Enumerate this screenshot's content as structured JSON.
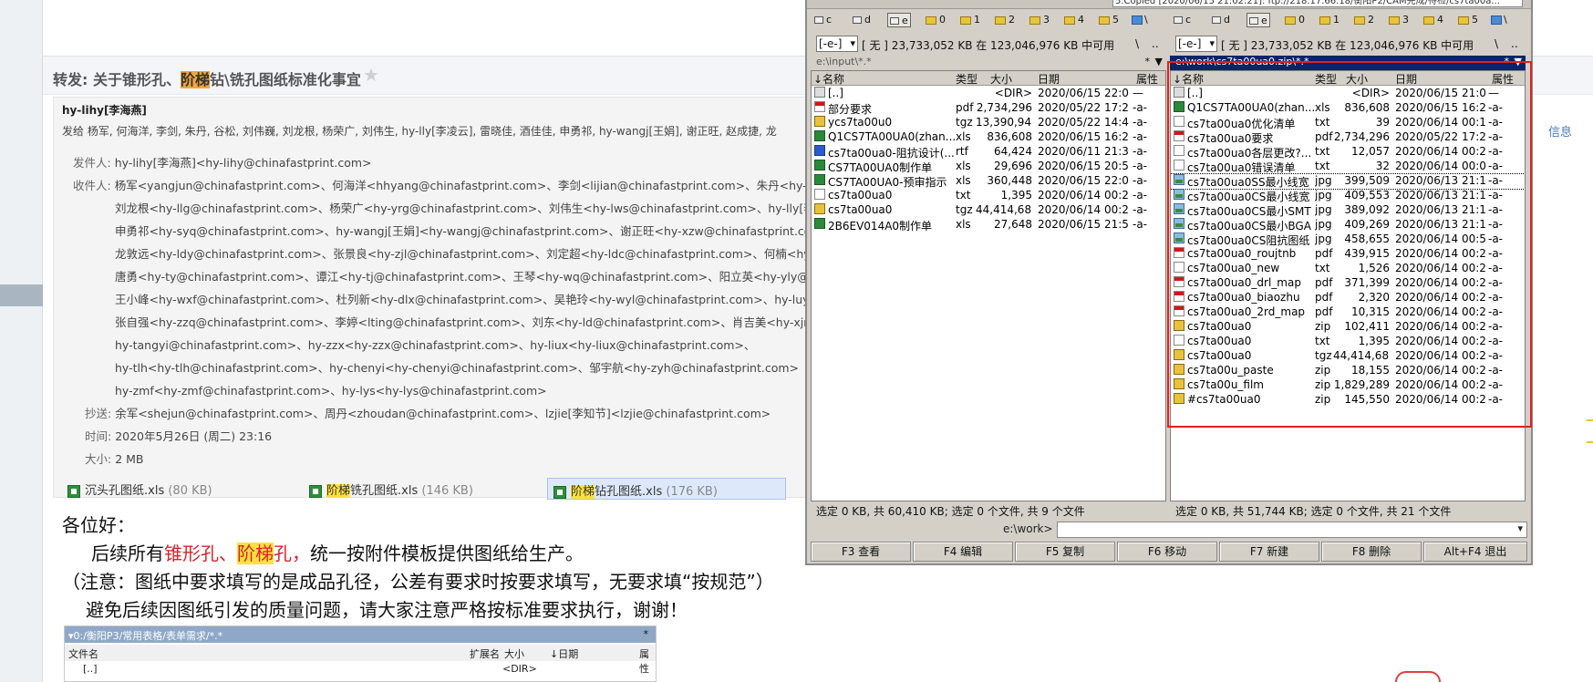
{
  "mail": {
    "subject_prefix": "转发: 关于锥形孔、",
    "subject_highlight": "阶梯",
    "subject_suffix": "钻\\铣孔图纸标准化事宜",
    "sender_name": "hy-lihy[李海燕]",
    "send_to_list": "发给 杨军, 何海洋, 李剑, 朱丹, 谷松, 刘伟巍, 刘龙根, 杨荣广, 刘伟生, hy-lly[李凌云], 雷晓佳, 酒佳佳, 申勇祁, hy-wangj[王娟], 谢正旺, 赵成捷, 龙",
    "right_info": "信息",
    "from_label": "发件人:",
    "from_value": "hy-lihy[李海燕]<hy-lihy@chinafastprint.com>",
    "to_label": "收件人:",
    "to_lines": [
      "杨军<yangjun@chinafastprint.com>、何海洋<hhyang@chinafastprint.com>、李剑<lijian@chinafastprint.com>、朱丹<hy-zd",
      "刘龙根<hy-llg@chinafastprint.com>、杨荣广<hy-yrg@chinafastprint.com>、刘伟生<hy-lws@chinafastprint.com>、hy-lly[李",
      "申勇祁<hy-syq@chinafastprint.com>、hy-wangj[王娟]<hy-wangj@chinafastprint.com>、谢正旺<hy-xzw@chinafastprint.com",
      "龙敦远<hy-ldy@chinafastprint.com>、张景良<hy-zjl@chinafastprint.com>、刘定超<hy-ldc@chinafastprint.com>、何楠<hy",
      "唐勇<hy-ty@chinafastprint.com>、谭江<hy-tj@chinafastprint.com>、王琴<hy-wq@chinafastprint.com>、阳立英<hy-yly@",
      "王小峰<hy-wxf@chinafastprint.com>、杜列新<hy-dlx@chinafastprint.com>、吴艳玲<hy-wyl@chinafastprint.com>、hy-luy",
      "张自强<hy-zzq@chinafastprint.com>、李婷<lting@chinafastprint.com>、刘东<hy-ld@chinafastprint.com>、肖吉美<hy-xjm",
      "hy-tangyi@chinafastprint.com>、hy-zzx<hy-zzx@chinafastprint.com>、hy-liux<hy-liux@chinafastprint.com>、",
      "hy-tlh<hy-tlh@chinafastprint.com>、hy-chenyi<hy-chenyi@chinafastprint.com>、邹宇航<hy-zyh@chinafastprint.com>",
      "hy-zmf<hy-zmf@chinafastprint.com>、hy-lys<hy-lys@chinafastprint.com>"
    ],
    "cc_label": "抄送:",
    "cc_value": "余军<shejun@chinafastprint.com>、周丹<zhoudan@chinafastprint.com>、lzjie[李知节]<lzjie@chinafastprint.com>",
    "time_label": "时间:",
    "time_value": "2020年5月26日 (周二) 23:16",
    "size_label": "大小:",
    "size_value": "2 MB",
    "attachments": [
      {
        "pre": "",
        "hl": "",
        "post": "沉头孔图纸.xls",
        "size": "(80 KB)"
      },
      {
        "pre": "",
        "hl": "阶梯",
        "post": "铣孔图纸.xls",
        "size": "(146 KB)"
      },
      {
        "pre": "",
        "hl": "阶梯",
        "post": "钻孔图纸.xls",
        "size": "(176 KB)"
      }
    ],
    "body": {
      "greeting": "各位好：",
      "line1_pre": "后续所有",
      "line1_red1": "锥形孔、",
      "line1_hl": "阶梯",
      "line1_red2": "孔，",
      "line1_post": "统一按附件模板提供图纸给生产。",
      "line2": "（注意：图纸中要求填写的是成品孔径，公差有要求时按要求填写，无要求填“按规范”）",
      "line3": "避免后续因图纸引发的质量问题，请大家注意严格按标准要求执行，谢谢！"
    },
    "embed": {
      "path": "▾0:/衡阳P3/常用表格/表单需求/*.*",
      "star": "*",
      "cols": {
        "name": "文件名",
        "ext": "扩展名",
        "size": "大小",
        "date": "↓日期",
        "attr": "属性"
      },
      "row1_name": "[..]",
      "row1_size": "<DIR>"
    }
  },
  "tc": {
    "top_message": "5.Copied [2020/06/15 21:02:21]: ftp://218.17.66.18/衡阳P2/CAM完成/待检/cs7ta00a...",
    "drives": [
      "c",
      "d",
      "e",
      "0",
      "1",
      "2",
      "3",
      "4",
      "5",
      "\\"
    ],
    "active_drive": "e",
    "left": {
      "drive_sel": "[-e-]",
      "space": "[ 无 ]  23,733,052 KB 在 123,046,976 KB 中可用",
      "back": "\\",
      "up": "..",
      "path": "e:\\input\\*.*",
      "star": "*",
      "arrow": "▼",
      "cols": {
        "name": "↓名称",
        "ext": "类型",
        "size": "大小",
        "date": "日期",
        "attr": "属性"
      },
      "files": [
        {
          "icon": "up",
          "name": "[..]",
          "ext": "",
          "size": "<DIR>",
          "date": "2020/06/15 22:09",
          "attr": "—"
        },
        {
          "icon": "pdf",
          "name": "部分要求",
          "ext": "pdf",
          "size": "2,734,296",
          "date": "2020/05/22 17:29",
          "attr": "-a-"
        },
        {
          "icon": "tgz",
          "name": "ycs7ta00u0",
          "ext": "tgz",
          "size": "13,390,947",
          "date": "2020/05/22 14:48",
          "attr": "-a-"
        },
        {
          "icon": "xls",
          "name": "Q1CS7TA00UA0(zhan...",
          "ext": "xls",
          "size": "836,608",
          "date": "2020/06/15 16:27",
          "attr": "-a-"
        },
        {
          "icon": "rtf",
          "name": "cs7ta00ua0-阻抗设计(...",
          "ext": "rtf",
          "size": "64,424",
          "date": "2020/06/11 21:39",
          "attr": "-a-"
        },
        {
          "icon": "xls",
          "name": "CS7TA00UA0制作单",
          "ext": "xls",
          "size": "29,696",
          "date": "2020/06/15 20:59",
          "attr": "-a-"
        },
        {
          "icon": "xls",
          "name": "CS7TA00UA0-预审指示",
          "ext": "xls",
          "size": "360,448",
          "date": "2020/06/15 22:09",
          "attr": "-a-"
        },
        {
          "icon": "txt",
          "name": "cs7ta00ua0",
          "ext": "txt",
          "size": "1,395",
          "date": "2020/06/14 00:20",
          "attr": "-a-"
        },
        {
          "icon": "tgz",
          "name": "cs7ta00ua0",
          "ext": "tgz",
          "size": "44,414,689",
          "date": "2020/06/14 00:24",
          "attr": "-a-"
        },
        {
          "icon": "xls",
          "name": "2B6EV014A0制作单",
          "ext": "xls",
          "size": "27,648",
          "date": "2020/06/15 21:59",
          "attr": "-a-"
        }
      ],
      "status": "选定 0 KB, 共 60,410 KB; 选定 0 个文件, 共 9 个文件"
    },
    "right": {
      "drive_sel": "[-e-]",
      "space": "[ 无 ]  23,733,052 KB 在 123,046,976 KB 中可用",
      "back": "\\",
      "up": "..",
      "path": "e:\\work\\cs7ta00ua0.zip\\*.*",
      "star": "*",
      "arrow": "▼",
      "cols": {
        "name": "↓名称",
        "ext": "类型",
        "size": "大小",
        "date": "日期",
        "attr": "属性"
      },
      "files": [
        {
          "icon": "up",
          "name": "[..]",
          "ext": "",
          "size": "<DIR>",
          "date": "2020/06/15 21:02",
          "attr": "—"
        },
        {
          "icon": "xls",
          "name": "Q1CS7TA00UA0(zhan...",
          "ext": "xls",
          "size": "836,608",
          "date": "2020/06/15 16:27",
          "attr": "-a-"
        },
        {
          "icon": "txt",
          "name": "cs7ta00ua0优化清单",
          "ext": "txt",
          "size": "39",
          "date": "2020/06/14 00:19",
          "attr": "-a-"
        },
        {
          "icon": "pdf",
          "name": "cs7ta00ua0要求",
          "ext": "pdf",
          "size": "2,734,296",
          "date": "2020/05/22 17:29",
          "attr": "-a-"
        },
        {
          "icon": "txt",
          "name": "cs7ta00ua0各层更改?...",
          "ext": "txt",
          "size": "12,057",
          "date": "2020/06/14 00:20",
          "attr": "-a-"
        },
        {
          "icon": "txt",
          "name": "cs7ta00ua0错误清单",
          "ext": "txt",
          "size": "32",
          "date": "2020/06/14 00:09",
          "attr": "-a-"
        },
        {
          "icon": "jpg",
          "name": "cs7ta00ua0SS最小线宽",
          "ext": "jpg",
          "size": "399,509",
          "date": "2020/06/13 21:13",
          "attr": "-a-"
        },
        {
          "icon": "jpg",
          "name": "cs7ta00ua0CS最小线宽",
          "ext": "jpg",
          "size": "409,553",
          "date": "2020/06/13 21:13",
          "attr": "-a-"
        },
        {
          "icon": "jpg",
          "name": "cs7ta00ua0CS最小SMT",
          "ext": "jpg",
          "size": "389,092",
          "date": "2020/06/13 21:13",
          "attr": "-a-"
        },
        {
          "icon": "jpg",
          "name": "cs7ta00ua0CS最小BGA",
          "ext": "jpg",
          "size": "409,269",
          "date": "2020/06/13 21:13",
          "attr": "-a-"
        },
        {
          "icon": "jpg",
          "name": "cs7ta00ua0CS阻抗图纸",
          "ext": "jpg",
          "size": "458,655",
          "date": "2020/06/14 00:59",
          "attr": "-a-"
        },
        {
          "icon": "pdf",
          "name": "cs7ta00ua0_roujtnb",
          "ext": "pdf",
          "size": "439,915",
          "date": "2020/06/14 00:20",
          "attr": "-a-"
        },
        {
          "icon": "txt",
          "name": "cs7ta00ua0_new",
          "ext": "txt",
          "size": "1,526",
          "date": "2020/06/14 00:20",
          "attr": "-a-"
        },
        {
          "icon": "pdf",
          "name": "cs7ta00ua0_drl_map",
          "ext": "pdf",
          "size": "371,399",
          "date": "2020/06/14 00:20",
          "attr": "-a-"
        },
        {
          "icon": "pdf",
          "name": "cs7ta00ua0_biaozhu",
          "ext": "pdf",
          "size": "2,320",
          "date": "2020/06/14 00:20",
          "attr": "-a-"
        },
        {
          "icon": "pdf",
          "name": "cs7ta00ua0_2rd_map",
          "ext": "pdf",
          "size": "10,315",
          "date": "2020/06/14 00:20",
          "attr": "-a-"
        },
        {
          "icon": "zip",
          "name": "cs7ta00ua0",
          "ext": "zip",
          "size": "102,411",
          "date": "2020/06/14 00:29",
          "attr": "-a-"
        },
        {
          "icon": "txt",
          "name": "cs7ta00ua0",
          "ext": "txt",
          "size": "1,395",
          "date": "2020/06/14 00:20",
          "attr": "-a-"
        },
        {
          "icon": "tgz",
          "name": "cs7ta00ua0",
          "ext": "tgz",
          "size": "44,414,689",
          "date": "2020/06/14 00:24",
          "attr": "-a-"
        },
        {
          "icon": "zip",
          "name": "cs7ta00u_paste",
          "ext": "zip",
          "size": "18,155",
          "date": "2020/06/14 00:23",
          "attr": "-a-"
        },
        {
          "icon": "zip",
          "name": "cs7ta00u_film",
          "ext": "zip",
          "size": "1,829,289",
          "date": "2020/06/14 00:23",
          "attr": "-a-"
        },
        {
          "icon": "zip",
          "name": "#cs7ta00ua0",
          "ext": "zip",
          "size": "145,550",
          "date": "2020/06/14 00:29",
          "attr": "-a-"
        }
      ],
      "status": "选定 0 KB, 共 51,744 KB; 选定 0 个文件, 共 21 个文件"
    },
    "cmd_prompt": "e:\\work>",
    "fkeys": [
      "F3 查看",
      "F4 编辑",
      "F5 复制",
      "F6 移动",
      "F7 新建",
      "F8 删除",
      "Alt+F4 退出"
    ]
  },
  "colors": {
    "highlight": "#f3a63c",
    "red_text": "#d9232c",
    "annotation_box": "#e02020",
    "tc_active_path": "#0a246a"
  }
}
